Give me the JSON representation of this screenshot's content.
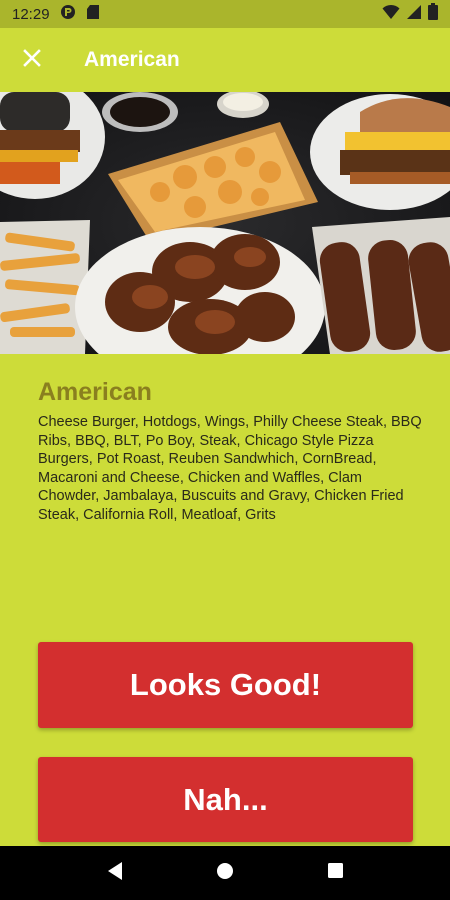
{
  "status_bar": {
    "time": "12:29"
  },
  "app_bar": {
    "title": "American"
  },
  "content": {
    "title": "American",
    "description": "Cheese Burger, Hotdogs, Wings, Philly Cheese Steak, BBQ Ribs, BBQ,  BLT, Po Boy, Steak, Chicago Style Pizza Burgers, Pot Roast, Reuben Sandwhich, CornBread, Macaroni and Cheese, Chicken and Waffles, Clam Chowder,   Jambalaya, Buscuits and Gravy, Chicken Fried Steak, California Roll, Meatloaf, Grits"
  },
  "buttons": {
    "accept_label": "Looks Good!",
    "reject_label": "Nah..."
  },
  "icons": {
    "close": "close-icon",
    "back": "back-triangle-icon",
    "home": "home-circle-icon",
    "recents": "recents-square-icon"
  },
  "colors": {
    "background": "#cddc39",
    "status_bar": "#aab52c",
    "button": "#d32f2f",
    "title": "#8a7f1f"
  }
}
